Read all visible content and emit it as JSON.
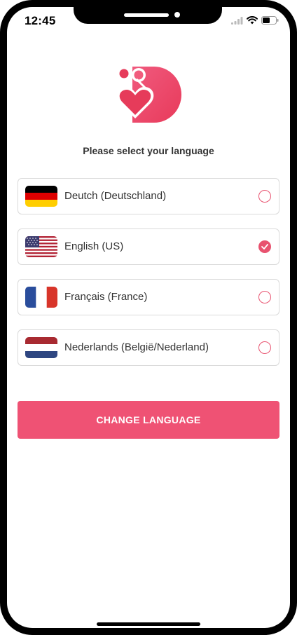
{
  "status_bar": {
    "time": "12:45"
  },
  "screen": {
    "title": "Please select your language"
  },
  "languages": [
    {
      "label": "Deutch (Deutschland)",
      "flag": "germany-flag-icon",
      "selected": false
    },
    {
      "label": "English (US)",
      "flag": "usa-flag-icon",
      "selected": true
    },
    {
      "label": "Français (France)",
      "flag": "france-flag-icon",
      "selected": false
    },
    {
      "label": "Nederlands (België/Nederland)",
      "flag": "netherlands-flag-icon",
      "selected": false
    }
  ],
  "button": {
    "change_label": "CHANGE LANGUAGE"
  },
  "colors": {
    "accent": "#ef5274",
    "radio": "#e8526f",
    "border": "#dadada",
    "text": "#333333"
  }
}
